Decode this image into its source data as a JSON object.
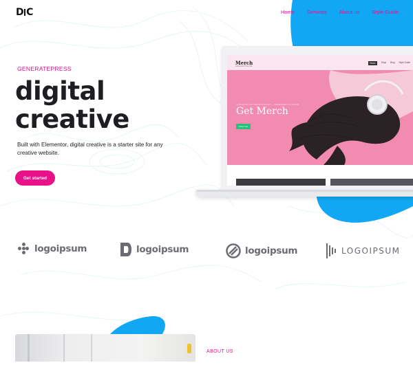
{
  "header": {
    "logo_left": "D",
    "logo_right": "C",
    "nav": [
      "Home",
      "Services",
      "About us",
      "Style Guide"
    ]
  },
  "hero": {
    "eyebrow": "GENERATEPRESS",
    "title_line1": "digital",
    "title_line2": "creative",
    "description": "Built with Elementor, digital creative is a starter site for any creative website.",
    "cta_label": "Get started"
  },
  "mockup": {
    "brand": "Merch",
    "brand_sub": "A Generate Press Site",
    "nav": [
      "Home",
      "Shop",
      "Blog",
      "Style Guide"
    ],
    "kicker": "A PRODUCT IN THE SPOTLIGHT — DESIGNED TO STAND",
    "title": "Get Merch",
    "button": "Shop now"
  },
  "logos": [
    {
      "text": "logoipsum",
      "icon": "dots-cluster-icon"
    },
    {
      "text": "logoipsum",
      "icon": "bracket-shape-icon"
    },
    {
      "text": "logoipsum",
      "icon": "circle-slash-icon"
    },
    {
      "text": "LOGOIPSUM",
      "icon": "bars-icon"
    }
  ],
  "about": {
    "label": "ABOUT US"
  },
  "colors": {
    "accent": "#e2128e",
    "blob": "#12a7f4",
    "mockup_pink": "#f28bb0",
    "logo_gray": "#6b6c72"
  }
}
